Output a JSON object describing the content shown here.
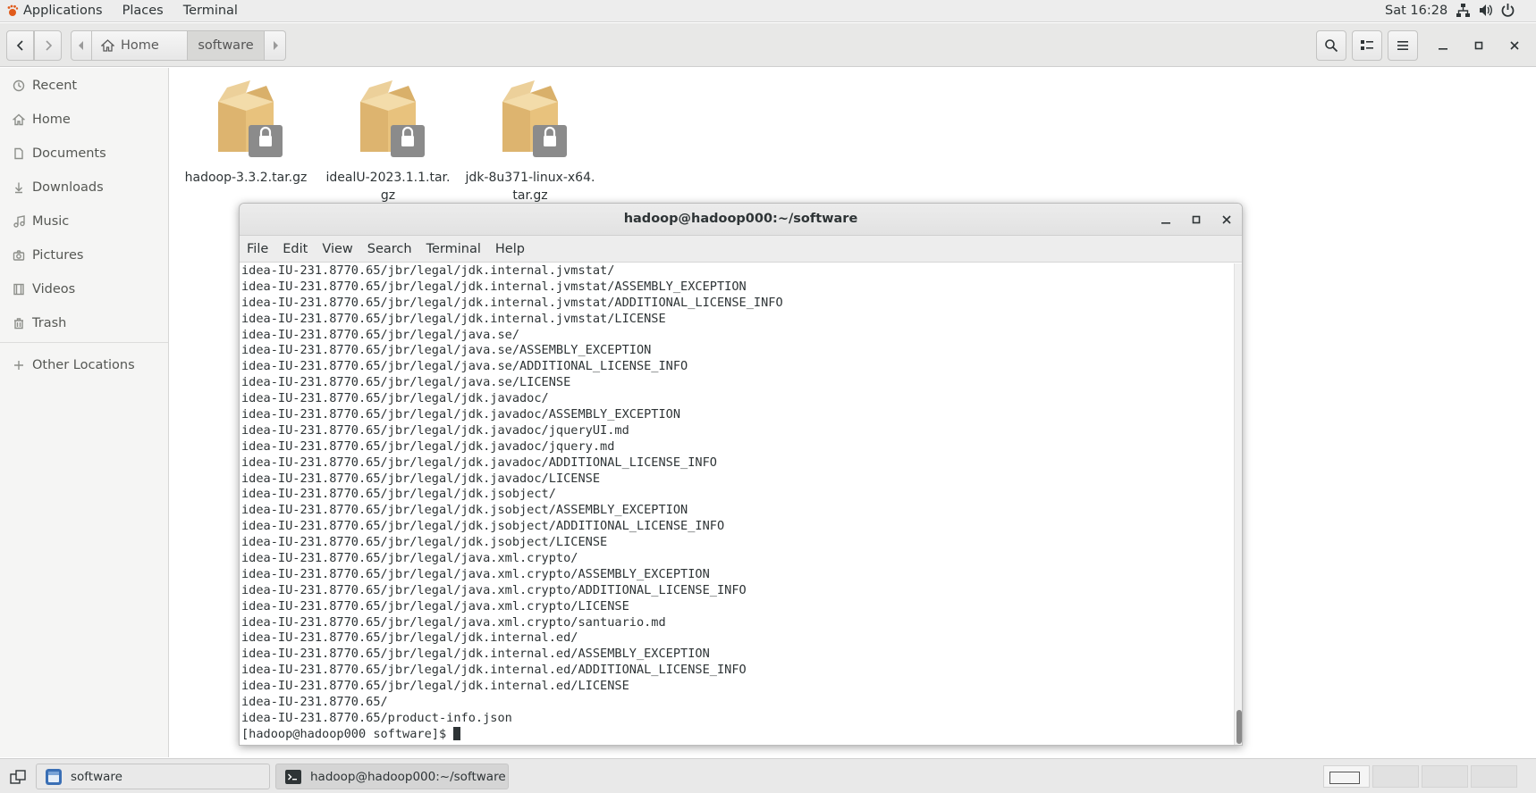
{
  "topbar": {
    "menu": [
      "Applications",
      "Places",
      "Terminal"
    ],
    "clock": "Sat 16:28"
  },
  "nautilus": {
    "path": [
      "Home",
      "software"
    ]
  },
  "sidebar": {
    "items": [
      "Recent",
      "Home",
      "Documents",
      "Downloads",
      "Music",
      "Pictures",
      "Videos",
      "Trash"
    ],
    "other": "Other Locations"
  },
  "files": [
    {
      "line1": "hadoop-3.3.2.tar.gz",
      "line2": ""
    },
    {
      "line1": "idealU-2023.1.1.tar.",
      "line2": "gz"
    },
    {
      "line1": "jdk-8u371-linux-x64.",
      "line2": "tar.gz"
    }
  ],
  "terminal": {
    "title": "hadoop@hadoop000:~/software",
    "menu": [
      "File",
      "Edit",
      "View",
      "Search",
      "Terminal",
      "Help"
    ],
    "lines": [
      "idea-IU-231.8770.65/jbr/legal/jdk.internal.jvmstat/",
      "idea-IU-231.8770.65/jbr/legal/jdk.internal.jvmstat/ASSEMBLY_EXCEPTION",
      "idea-IU-231.8770.65/jbr/legal/jdk.internal.jvmstat/ADDITIONAL_LICENSE_INFO",
      "idea-IU-231.8770.65/jbr/legal/jdk.internal.jvmstat/LICENSE",
      "idea-IU-231.8770.65/jbr/legal/java.se/",
      "idea-IU-231.8770.65/jbr/legal/java.se/ASSEMBLY_EXCEPTION",
      "idea-IU-231.8770.65/jbr/legal/java.se/ADDITIONAL_LICENSE_INFO",
      "idea-IU-231.8770.65/jbr/legal/java.se/LICENSE",
      "idea-IU-231.8770.65/jbr/legal/jdk.javadoc/",
      "idea-IU-231.8770.65/jbr/legal/jdk.javadoc/ASSEMBLY_EXCEPTION",
      "idea-IU-231.8770.65/jbr/legal/jdk.javadoc/jqueryUI.md",
      "idea-IU-231.8770.65/jbr/legal/jdk.javadoc/jquery.md",
      "idea-IU-231.8770.65/jbr/legal/jdk.javadoc/ADDITIONAL_LICENSE_INFO",
      "idea-IU-231.8770.65/jbr/legal/jdk.javadoc/LICENSE",
      "idea-IU-231.8770.65/jbr/legal/jdk.jsobject/",
      "idea-IU-231.8770.65/jbr/legal/jdk.jsobject/ASSEMBLY_EXCEPTION",
      "idea-IU-231.8770.65/jbr/legal/jdk.jsobject/ADDITIONAL_LICENSE_INFO",
      "idea-IU-231.8770.65/jbr/legal/jdk.jsobject/LICENSE",
      "idea-IU-231.8770.65/jbr/legal/java.xml.crypto/",
      "idea-IU-231.8770.65/jbr/legal/java.xml.crypto/ASSEMBLY_EXCEPTION",
      "idea-IU-231.8770.65/jbr/legal/java.xml.crypto/ADDITIONAL_LICENSE_INFO",
      "idea-IU-231.8770.65/jbr/legal/java.xml.crypto/LICENSE",
      "idea-IU-231.8770.65/jbr/legal/java.xml.crypto/santuario.md",
      "idea-IU-231.8770.65/jbr/legal/jdk.internal.ed/",
      "idea-IU-231.8770.65/jbr/legal/jdk.internal.ed/ASSEMBLY_EXCEPTION",
      "idea-IU-231.8770.65/jbr/legal/jdk.internal.ed/ADDITIONAL_LICENSE_INFO",
      "idea-IU-231.8770.65/jbr/legal/jdk.internal.ed/LICENSE",
      "idea-IU-231.8770.65/",
      "idea-IU-231.8770.65/product-info.json"
    ],
    "prompt": "[hadoop@hadoop000 software]$ "
  },
  "taskbar": {
    "tasks": [
      "software",
      "hadoop@hadoop000:~/software"
    ]
  }
}
